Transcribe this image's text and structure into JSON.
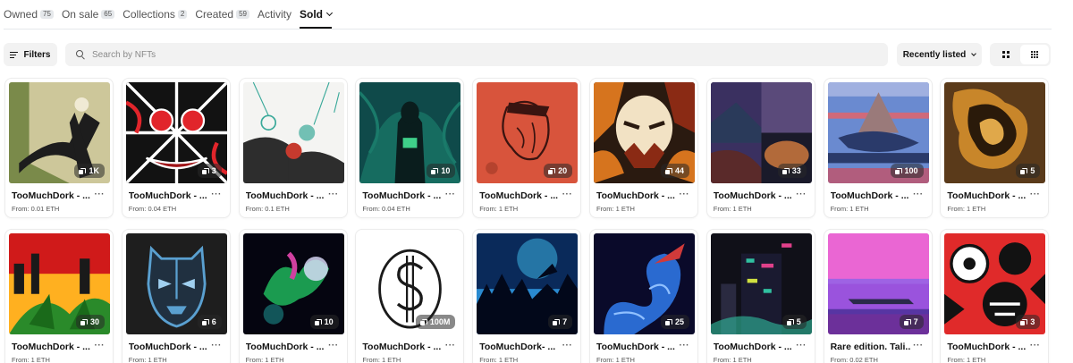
{
  "tabs": [
    {
      "label": "Owned",
      "count": "75"
    },
    {
      "label": "On sale",
      "count": "65"
    },
    {
      "label": "Collections",
      "count": "2"
    },
    {
      "label": "Created",
      "count": "59"
    },
    {
      "label": "Activity",
      "count": ""
    },
    {
      "label": "Sold",
      "count": ""
    }
  ],
  "toolbar": {
    "filters_label": "Filters",
    "search_placeholder": "Search by NFTs",
    "search_value": "",
    "sort_label": "Recently listed",
    "view_modes": [
      "grid-large-icon",
      "grid-small-icon"
    ]
  },
  "cards": [
    {
      "name": "TooMuchDork - ...",
      "price": "From: 0.01 ETH",
      "editions": "1K",
      "palette": [
        "#cdc79a",
        "#1d1d1d",
        "#7a8a4a",
        "#f0ead4"
      ]
    },
    {
      "name": "TooMuchDork - ...",
      "price": "From: 0.04 ETH",
      "editions": "3",
      "palette": [
        "#121212",
        "#e1252b",
        "#ffffff",
        "#a01418"
      ]
    },
    {
      "name": "TooMuchDork - ...",
      "price": "From: 0.1 ETH",
      "editions": "",
      "palette": [
        "#f4f4f2",
        "#2d2d2d",
        "#3aa99a",
        "#c63a2e"
      ]
    },
    {
      "name": "TooMuchDork - ...",
      "price": "From: 0.04 ETH",
      "editions": "10",
      "palette": [
        "#0f4a4a",
        "#1a7a6a",
        "#0a1d1d",
        "#3fd08a"
      ]
    },
    {
      "name": "TooMuchDork - ...",
      "price": "From: 1 ETH",
      "editions": "20",
      "palette": [
        "#d8543c",
        "#3a1410",
        "#e7735a",
        "#b5432e"
      ]
    },
    {
      "name": "TooMuchDork - ...",
      "price": "From: 1 ETH",
      "editions": "44",
      "palette": [
        "#2a1a10",
        "#d6741e",
        "#f2e2c4",
        "#8a2a14"
      ]
    },
    {
      "name": "TooMuchDork - ...",
      "price": "From: 1 ETH",
      "editions": "33",
      "palette": [
        "#3a3060",
        "#1a1a2a",
        "#b26a3a",
        "#5a2a2a"
      ]
    },
    {
      "name": "TooMuchDork - ...",
      "price": "From: 1 ETH",
      "editions": "100",
      "palette": [
        "#6a8ad0",
        "#d04a5a",
        "#2a3a6a",
        "#9a7a7a"
      ]
    },
    {
      "name": "TooMuchDork - ...",
      "price": "From: 1 ETH",
      "editions": "5",
      "palette": [
        "#5a3a1a",
        "#c8862a",
        "#2a1a0a",
        "#e0a84a"
      ]
    },
    {
      "name": "TooMuchDork - ...",
      "price": "From: 1 ETH",
      "editions": "30",
      "palette": [
        "#d01a1a",
        "#ffb020",
        "#1a1a1a",
        "#2a8a2a"
      ]
    },
    {
      "name": "TooMuchDork - ...",
      "price": "From: 1 ETH",
      "editions": "6",
      "palette": [
        "#1e1e1e",
        "#5aa0d0",
        "#203040",
        "#a0d0f0"
      ]
    },
    {
      "name": "TooMuchDork - ...",
      "price": "From: 1 ETH",
      "editions": "10",
      "palette": [
        "#050510",
        "#20c060",
        "#d040a0",
        "#e0e0ff"
      ]
    },
    {
      "name": "TooMuchDork - ...",
      "price": "From: 1 ETH",
      "editions": "100M",
      "palette": [
        "#ffffff",
        "#1a1a1a",
        "#bbbbbb",
        "#f4f4f4"
      ]
    },
    {
      "name": "TooMuchDork- ...",
      "price": "From: 1 ETH",
      "editions": "7",
      "palette": [
        "#0a2a5a",
        "#2a8ad0",
        "#02081a",
        "#40c0f0"
      ]
    },
    {
      "name": "TooMuchDork - ...",
      "price": "From: 1 ETH",
      "editions": "25",
      "palette": [
        "#0a0a2a",
        "#2a6ad0",
        "#d03a3a",
        "#90c0ff"
      ]
    },
    {
      "name": "TooMuchDork - ...",
      "price": "From: 1 ETH",
      "editions": "5",
      "palette": [
        "#101018",
        "#30c0a0",
        "#e0408a",
        "#d0e040"
      ]
    },
    {
      "name": "Rare edition. Tali...",
      "price": "From: 0.02 ETH",
      "editions": "7",
      "palette": [
        "#e040c0",
        "#6a60f0",
        "#f080e0",
        "#3a2a8a"
      ]
    },
    {
      "name": "TooMuchDork - ...",
      "price": "From: 1 ETH",
      "editions": "3",
      "palette": [
        "#e02a2a",
        "#121212",
        "#ffffff",
        "#a01010"
      ]
    }
  ]
}
